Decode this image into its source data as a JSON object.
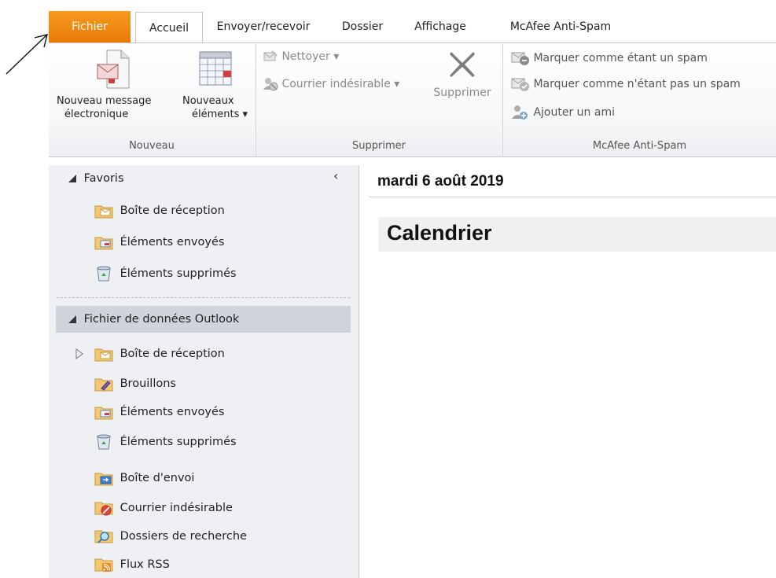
{
  "tabs": {
    "fichier": "Fichier",
    "accueil": "Accueil",
    "envoyer": "Envoyer/recevoir",
    "dossier": "Dossier",
    "affichage": "Affichage",
    "mcafee": "McAfee Anti-Spam"
  },
  "ribbon": {
    "nouveau": {
      "new_message_line1": "Nouveau message",
      "new_message_line2": "électronique",
      "new_items_line1": "Nouveaux",
      "new_items_line2": "éléments ▾",
      "label": "Nouveau"
    },
    "supprimer": {
      "nettoyer": "Nettoyer ▾",
      "courrier_indesirable": "Courrier indésirable ▾",
      "supprimer_btn": "Supprimer",
      "label": "Supprimer"
    },
    "mcafee": {
      "mark_spam": "Marquer comme étant un spam",
      "mark_not_spam": "Marquer comme n'étant pas un spam",
      "add_friend": "Ajouter un ami",
      "label": "McAfee Anti-Spam"
    }
  },
  "nav": {
    "favoris_header": "Favoris",
    "favoris": [
      "Boîte de réception",
      "Éléments envoyés",
      "Éléments supprimés"
    ],
    "datafile_header": "Fichier de données Outlook",
    "folders": [
      "Boîte de réception",
      "Brouillons",
      "Éléments envoyés",
      "Éléments supprimés",
      "Boîte d'envoi",
      "Courrier indésirable",
      "Dossiers de recherche",
      "Flux RSS"
    ]
  },
  "calendar": {
    "date": "mardi 6 août 2019",
    "title": "Calendrier"
  },
  "colors": {
    "fichier_tab": "#ea7a08",
    "nav_bg": "#eef0f4",
    "nav_selected": "#cfd4dc"
  }
}
